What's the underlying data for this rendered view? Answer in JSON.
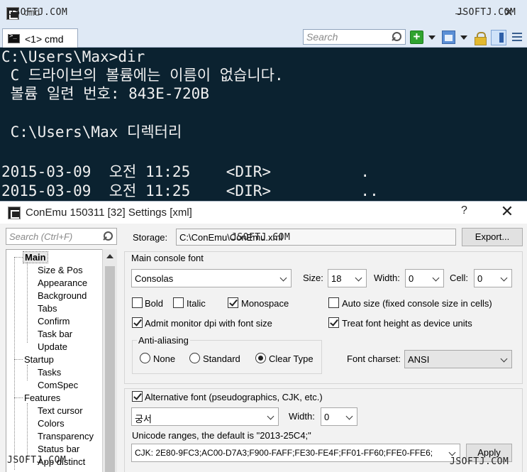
{
  "watermark": "JSOFTJ.COM",
  "window": {
    "title": "cmd",
    "close_glyph": "✕"
  },
  "tab": {
    "label": "<1> cmd"
  },
  "toolbar": {
    "search_placeholder": "Search",
    "add_glyph": "+"
  },
  "console": {
    "lines": [
      "C:\\Users\\Max>dir",
      " C 드라이브의 볼륨에는 이름이 없습니다.",
      " 볼륨 일련 번호: 843E-720B",
      "",
      " C:\\Users\\Max 디렉터리",
      "",
      "2015-03-09  오전 11:25    <DIR>          .",
      "2015-03-09  오전 11:25    <DIR>          .."
    ]
  },
  "settings": {
    "title": "ConEmu 150311 [32] Settings [xml]",
    "help_glyph": "?",
    "close_glyph": "✕",
    "tree_search_placeholder": "Search (Ctrl+F)",
    "tree": {
      "main": "Main",
      "main_children": [
        "Size & Pos",
        "Appearance",
        "Background",
        "Tabs",
        "Confirm",
        "Task bar",
        "Update"
      ],
      "startup": "Startup",
      "startup_children": [
        "Tasks",
        "ComSpec"
      ],
      "features": "Features",
      "features_children": [
        "Text cursor",
        "Colors",
        "Transparency",
        "Status bar",
        "App distinct"
      ]
    },
    "storage": {
      "label": "Storage:",
      "value": "C:\\ConEmu\\ConEmu.xml",
      "export_label": "Export..."
    },
    "main_font": {
      "group_label": "Main console font",
      "font_name": "Consolas",
      "size_label": "Size:",
      "size_value": "18",
      "width_label": "Width:",
      "width_value": "0",
      "cell_label": "Cell:",
      "cell_value": "0",
      "bold_label": "Bold",
      "bold_checked": false,
      "italic_label": "Italic",
      "italic_checked": false,
      "monospace_label": "Monospace",
      "monospace_checked": true,
      "auto_size_label": "Auto size (fixed console size in cells)",
      "auto_size_checked": false,
      "admin_dpi_label": "Admit monitor dpi with font size",
      "admin_dpi_checked": true,
      "treat_height_label": "Treat font height as device units",
      "treat_height_checked": true,
      "antialias_label": "Anti-aliasing",
      "aa_none": "None",
      "aa_standard": "Standard",
      "aa_cleartype": "Clear Type",
      "aa_selected": "Clear Type",
      "charset_label": "Font charset:",
      "charset_value": "ANSI"
    },
    "alt_font": {
      "label": "Alternative font (pseudographics, CJK, etc.)",
      "checked": true,
      "font_name": "궁서",
      "width_label": "Width:",
      "width_value": "0",
      "unicode_label": "Unicode ranges, the default is \"2013-25C4;\"",
      "ranges_value": "CJK: 2E80-9FC3;AC00-D7A3;F900-FAFF;FE30-FE4F;FF01-FF60;FFE0-FFE6;",
      "apply_label": "Apply"
    }
  }
}
